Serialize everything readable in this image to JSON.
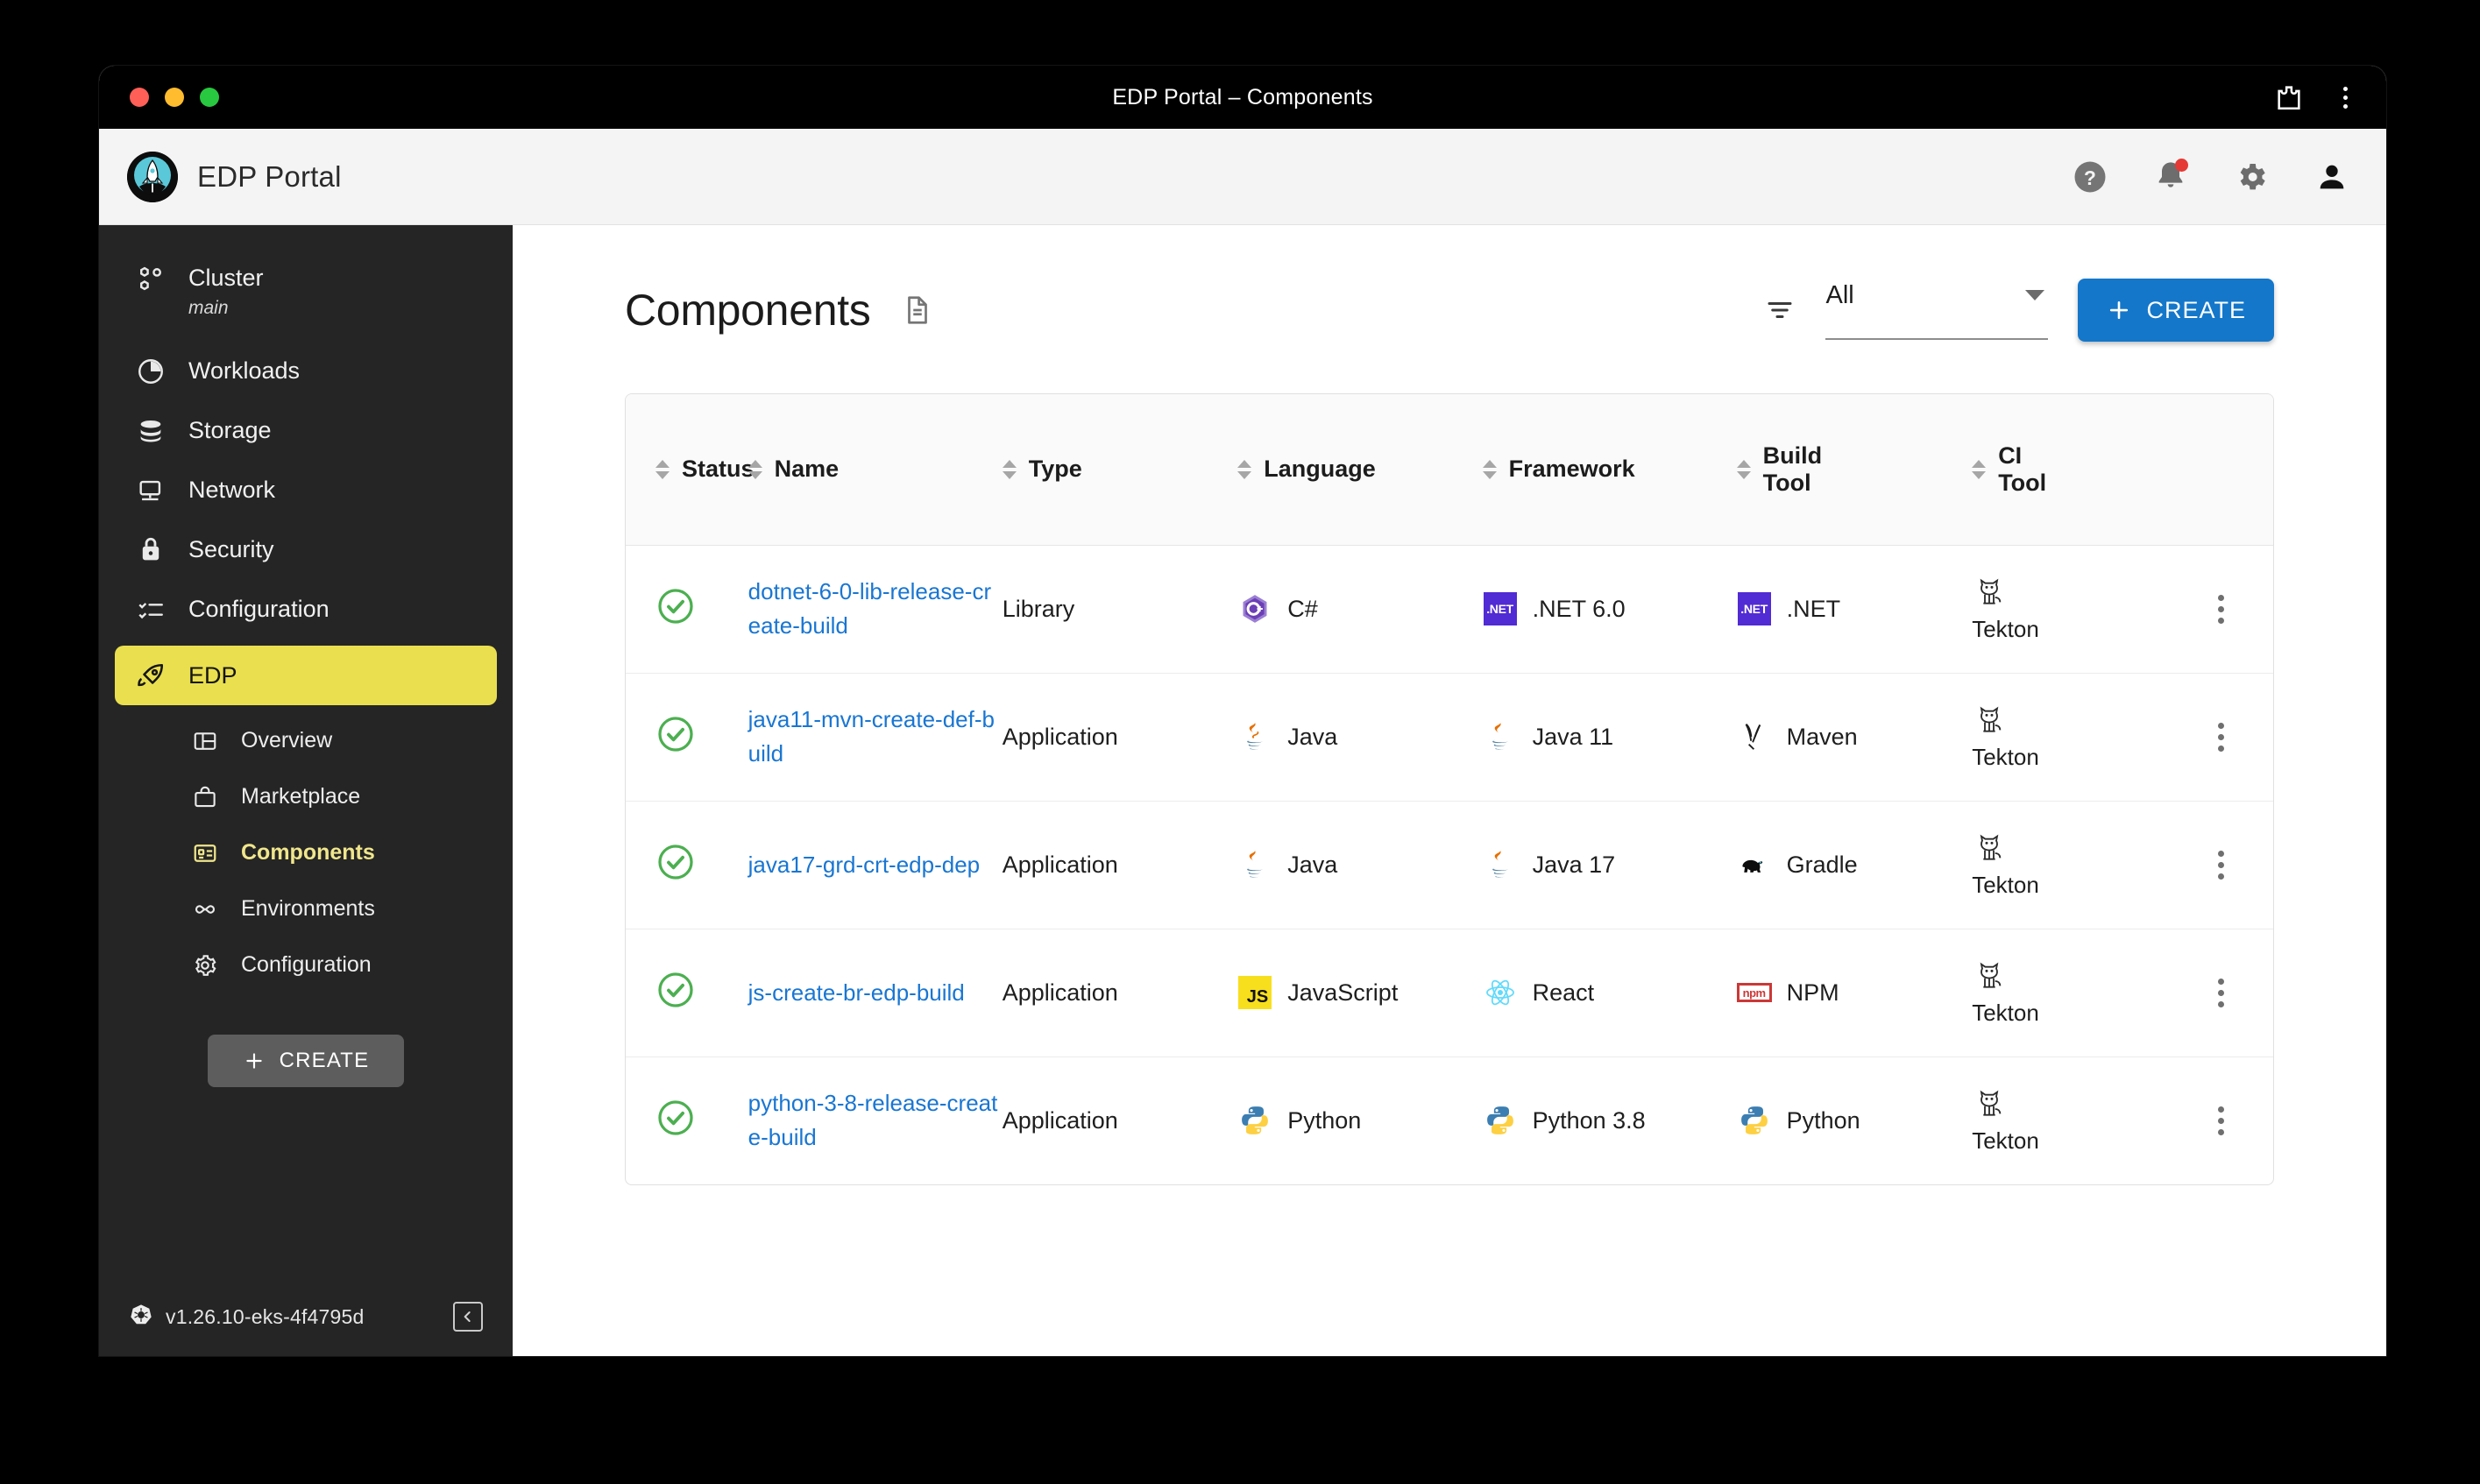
{
  "browser": {
    "window_title": "EDP Portal – Components",
    "traffic_lights": [
      "close",
      "minimize",
      "maximize"
    ],
    "right_icons": [
      "browser-extension-icon",
      "chrome-menu-icon"
    ]
  },
  "appbar": {
    "brand_name": "EDP Portal",
    "logo_icon": "rocket-logo-icon",
    "icons": [
      {
        "name": "help-icon",
        "label": "?"
      },
      {
        "name": "notifications-icon",
        "has_badge": true
      },
      {
        "name": "settings-gear-icon"
      },
      {
        "name": "user-account-icon"
      }
    ]
  },
  "sidebar": {
    "items": [
      {
        "label": "Cluster",
        "sub": "main",
        "icon": "cluster-icon"
      },
      {
        "label": "Workloads",
        "icon": "workloads-icon"
      },
      {
        "label": "Storage",
        "icon": "storage-icon"
      },
      {
        "label": "Network",
        "icon": "network-icon"
      },
      {
        "label": "Security",
        "icon": "security-lock-icon"
      },
      {
        "label": "Configuration",
        "icon": "configuration-icon"
      },
      {
        "label": "EDP",
        "icon": "rocket-icon",
        "active": true
      }
    ],
    "subitems": [
      {
        "label": "Overview",
        "icon": "overview-icon"
      },
      {
        "label": "Marketplace",
        "icon": "marketplace-icon"
      },
      {
        "label": "Components",
        "icon": "components-icon",
        "selected": true
      },
      {
        "label": "Environments",
        "icon": "environments-infinity-icon"
      },
      {
        "label": "Configuration",
        "icon": "gear-icon"
      }
    ],
    "create_label": "CREATE",
    "kubernetes_version": "v1.26.10-eks-4f4795d",
    "kubernetes_icon": "kubernetes-icon",
    "collapse_icon": "collapse-sidebar-icon"
  },
  "page": {
    "title": "Components",
    "doc_icon": "documentation-icon",
    "filter_icon": "filter-icon",
    "filter_value": "All",
    "create_label": "CREATE"
  },
  "table": {
    "columns": [
      {
        "label": "Status",
        "sortable": true
      },
      {
        "label": "Name",
        "sortable": true
      },
      {
        "label": "Type",
        "sortable": true
      },
      {
        "label": "Language",
        "sortable": true
      },
      {
        "label": "Framework",
        "sortable": true
      },
      {
        "label": "Build Tool",
        "sortable": true
      },
      {
        "label": "CI Tool",
        "sortable": true
      }
    ],
    "rows": [
      {
        "status": "ok",
        "name": "dotnet-6-0-lib-release-create-build",
        "type": "Library",
        "language": {
          "label": "C#",
          "icon": "csharp-icon"
        },
        "framework": {
          "label": ".NET 6.0",
          "icon": "dotnet-icon"
        },
        "build_tool": {
          "label": ".NET",
          "icon": "dotnet-icon"
        },
        "ci_tool": {
          "label": "Tekton",
          "icon": "tekton-cat-icon"
        }
      },
      {
        "status": "ok",
        "name": "java11-mvn-create-def-build",
        "type": "Application",
        "language": {
          "label": "Java",
          "icon": "java-icon"
        },
        "framework": {
          "label": "Java 11",
          "icon": "java-icon"
        },
        "build_tool": {
          "label": "Maven",
          "icon": "maven-icon"
        },
        "ci_tool": {
          "label": "Tekton",
          "icon": "tekton-cat-icon"
        }
      },
      {
        "status": "ok",
        "name": "java17-grd-crt-edp-dep",
        "type": "Application",
        "language": {
          "label": "Java",
          "icon": "java-icon"
        },
        "framework": {
          "label": "Java 17",
          "icon": "java-icon"
        },
        "build_tool": {
          "label": "Gradle",
          "icon": "gradle-elephant-icon"
        },
        "ci_tool": {
          "label": "Tekton",
          "icon": "tekton-cat-icon"
        }
      },
      {
        "status": "ok",
        "name": "js-create-br-edp-build",
        "type": "Application",
        "language": {
          "label": "JavaScript",
          "icon": "javascript-icon"
        },
        "framework": {
          "label": "React",
          "icon": "react-icon"
        },
        "build_tool": {
          "label": "NPM",
          "icon": "npm-icon"
        },
        "ci_tool": {
          "label": "Tekton",
          "icon": "tekton-cat-icon"
        }
      },
      {
        "status": "ok",
        "name": "python-3-8-release-create-build",
        "type": "Application",
        "language": {
          "label": "Python",
          "icon": "python-icon"
        },
        "framework": {
          "label": "Python 3.8",
          "icon": "python-icon"
        },
        "build_tool": {
          "label": "Python",
          "icon": "python-icon"
        },
        "ci_tool": {
          "label": "Tekton",
          "icon": "tekton-cat-icon"
        }
      }
    ],
    "row_menu_icon": "row-actions-kebab-icon",
    "status_ok_icon": "status-success-check-icon"
  },
  "colors": {
    "accent_blue": "#1477ca",
    "sidebar_bg": "#252525",
    "active_yellow": "#eadf4e",
    "link_blue": "#1976d2",
    "success_green": "#4caf50",
    "dotnet_purple": "#512bd4",
    "js_yellow": "#f7df1e",
    "npm_red": "#cb3837",
    "notification_red": "#e53935"
  }
}
